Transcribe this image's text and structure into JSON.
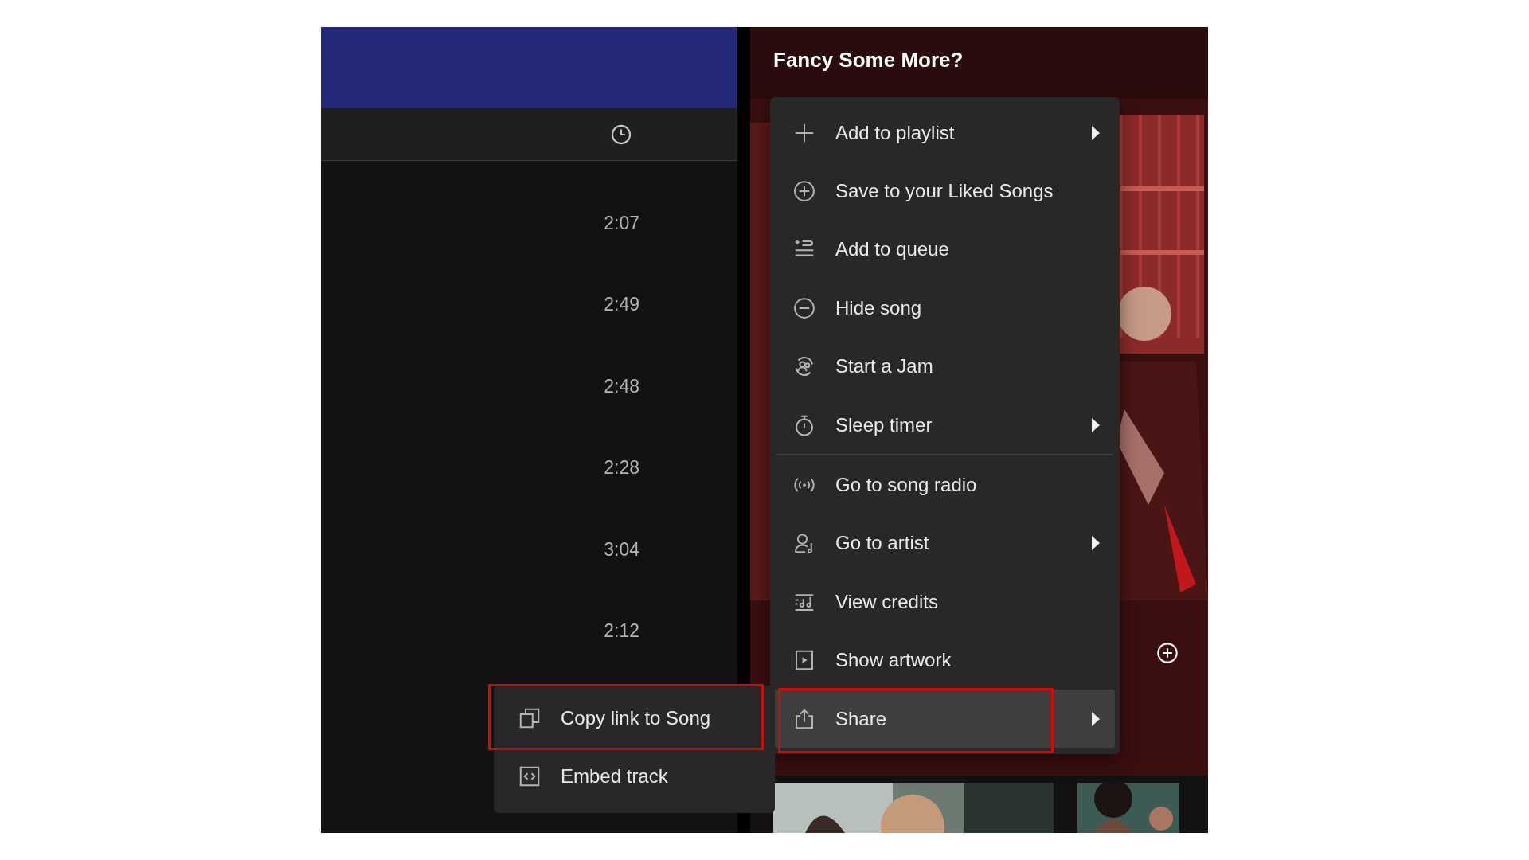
{
  "tracklist": {
    "header": {
      "kind": "duration"
    },
    "durations": [
      "2:07",
      "2:49",
      "2:48",
      "2:28",
      "3:04",
      "2:12"
    ]
  },
  "recommendations": {
    "title": "Fancy Some More?"
  },
  "context_menu": [
    {
      "kind": "item",
      "label": "Add to playlist",
      "has_submenu": true,
      "highlighted": false
    },
    {
      "kind": "item",
      "label": "Save to your Liked Songs",
      "has_submenu": false,
      "highlighted": false
    },
    {
      "kind": "item",
      "label": "Add to queue",
      "has_submenu": false,
      "highlighted": false
    },
    {
      "kind": "item",
      "label": "Hide song",
      "has_submenu": false,
      "highlighted": false
    },
    {
      "kind": "item",
      "label": "Start a Jam",
      "has_submenu": false,
      "highlighted": false
    },
    {
      "kind": "item",
      "label": "Sleep timer",
      "has_submenu": true,
      "highlighted": false
    },
    {
      "kind": "separator"
    },
    {
      "kind": "item",
      "label": "Go to song radio",
      "has_submenu": false,
      "highlighted": false
    },
    {
      "kind": "item",
      "label": "Go to artist",
      "has_submenu": true,
      "highlighted": false
    },
    {
      "kind": "item",
      "label": "View credits",
      "has_submenu": false,
      "highlighted": false
    },
    {
      "kind": "item",
      "label": "Show artwork",
      "has_submenu": false,
      "highlighted": false
    },
    {
      "kind": "item",
      "label": "Share",
      "has_submenu": true,
      "highlighted": true
    }
  ],
  "share_submenu": [
    {
      "label": "Copy link to Song",
      "highlighted": true
    },
    {
      "label": "Embed track",
      "highlighted": false
    }
  ]
}
